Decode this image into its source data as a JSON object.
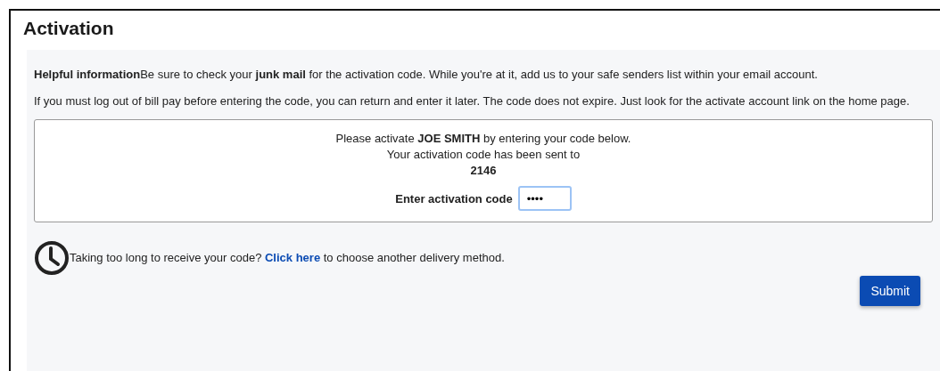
{
  "title": "Activation",
  "info": [
    "**Helpful information**Be sure to check your **junk mail** for the activation code. While you're at it, add us to your safe senders list within your email account.",
    "If you must log out of bill pay before entering the code, you can return and enter it later. The code does not expire. Just look for the activate account link on the home page."
  ],
  "code_box": {
    "lines": [
      "Please activate **JOE SMITH** by entering your code below.",
      "Your activation code has been sent to",
      "**2146**"
    ],
    "field_label": "Enter activation code",
    "field_value": "••••"
  },
  "delay_note": {
    "before": "Taking too long to receive your code? ",
    "link": "Click here",
    "after": " to choose another delivery method."
  },
  "submit": "Submit"
}
